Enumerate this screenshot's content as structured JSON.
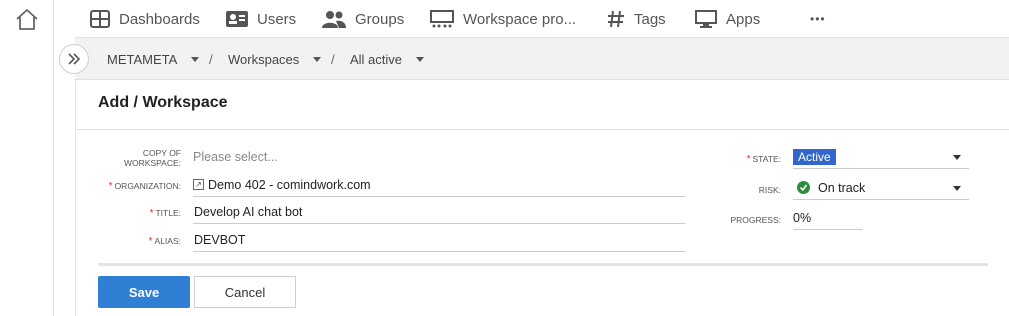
{
  "nav": {
    "items": [
      {
        "label": "Dashboards",
        "icon": "dashboard-grid-icon"
      },
      {
        "label": "Users",
        "icon": "user-card-icon"
      },
      {
        "label": "Groups",
        "icon": "group-people-icon"
      },
      {
        "label": "Workspace pro...",
        "icon": "workspace-projector-icon"
      },
      {
        "label": "Tags",
        "icon": "hash-tag-icon"
      },
      {
        "label": "Apps",
        "icon": "monitor-icon"
      }
    ],
    "more": "•••"
  },
  "breadcrumb": {
    "items": [
      "METAMETA",
      "Workspaces",
      "All active"
    ],
    "separator": "/"
  },
  "form": {
    "title": "Add / Workspace",
    "copy_of_workspace": {
      "label_line1": "COPY OF",
      "label_line2": "WORKSPACE:",
      "placeholder": "Please select..."
    },
    "organization": {
      "label": "ORGANIZATION:",
      "value": "Demo 402 - comindwork.com"
    },
    "title_field": {
      "label": "TITLE:",
      "value": "Develop AI chat bot"
    },
    "alias": {
      "label": "ALIAS:",
      "value": "DEVBOT"
    },
    "state": {
      "label": "STATE:",
      "value": "Active"
    },
    "risk": {
      "label": "RISK:",
      "value": "On track"
    },
    "progress": {
      "label": "PROGRESS:",
      "value": "0%"
    },
    "required_mark": "*"
  },
  "buttons": {
    "save": "Save",
    "cancel": "Cancel"
  },
  "colors": {
    "accent": "#2f7fd5",
    "state_badge": "#3366cc",
    "risk_ok": "#2e8b3b",
    "required": "#d9342b"
  }
}
